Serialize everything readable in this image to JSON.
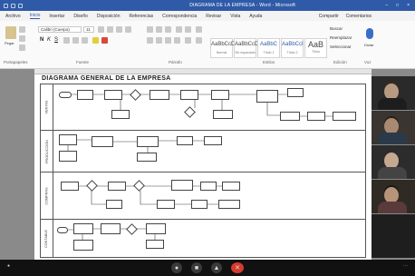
{
  "window": {
    "title": "DIAGRAMA DE LA EMPRESA - Word - Microsoft"
  },
  "tabs": [
    "Archivo",
    "Inicio",
    "Insertar",
    "Diseño",
    "Disposición",
    "Referencias",
    "Correspondencia",
    "Revisar",
    "Vista",
    "Ayuda"
  ],
  "tabs_right": [
    "Compartir",
    "Comentarios"
  ],
  "ribbon": {
    "font_name": "Calibri (Cuerpo)",
    "font_size": "11",
    "styles": [
      {
        "sample": "AaBbCcDc",
        "name": "Normal"
      },
      {
        "sample": "AaBbCcDc",
        "name": "Sin espaciado"
      },
      {
        "sample": "AaBbC",
        "name": "Título 1"
      },
      {
        "sample": "AaBbCcI",
        "name": "Título 2"
      },
      {
        "sample": "AaB",
        "name": "Título"
      }
    ],
    "editing": [
      "Buscar",
      "Reemplazar",
      "Seleccionar"
    ],
    "group_labels": [
      "Portapapeles",
      "Fuente",
      "Párrafo",
      "Estilos",
      "Edición",
      "Voz"
    ],
    "paste_label": "Pegar",
    "dictate_label": "Dictar"
  },
  "document": {
    "title": "DIAGRAMA GENERAL DE LA EMPRESA",
    "lanes": [
      "VENTAS",
      "PRODUCCIÓN",
      "COMPRAS",
      "CONTABLE"
    ]
  },
  "participants": [
    "participant-1",
    "participant-2",
    "participant-3",
    "participant-4",
    "participant-5"
  ],
  "meeting": {
    "mic_icon": "microphone-icon",
    "cam_icon": "camera-icon",
    "share_icon": "share-screen-icon",
    "hangup_icon": "hang-up-icon"
  }
}
